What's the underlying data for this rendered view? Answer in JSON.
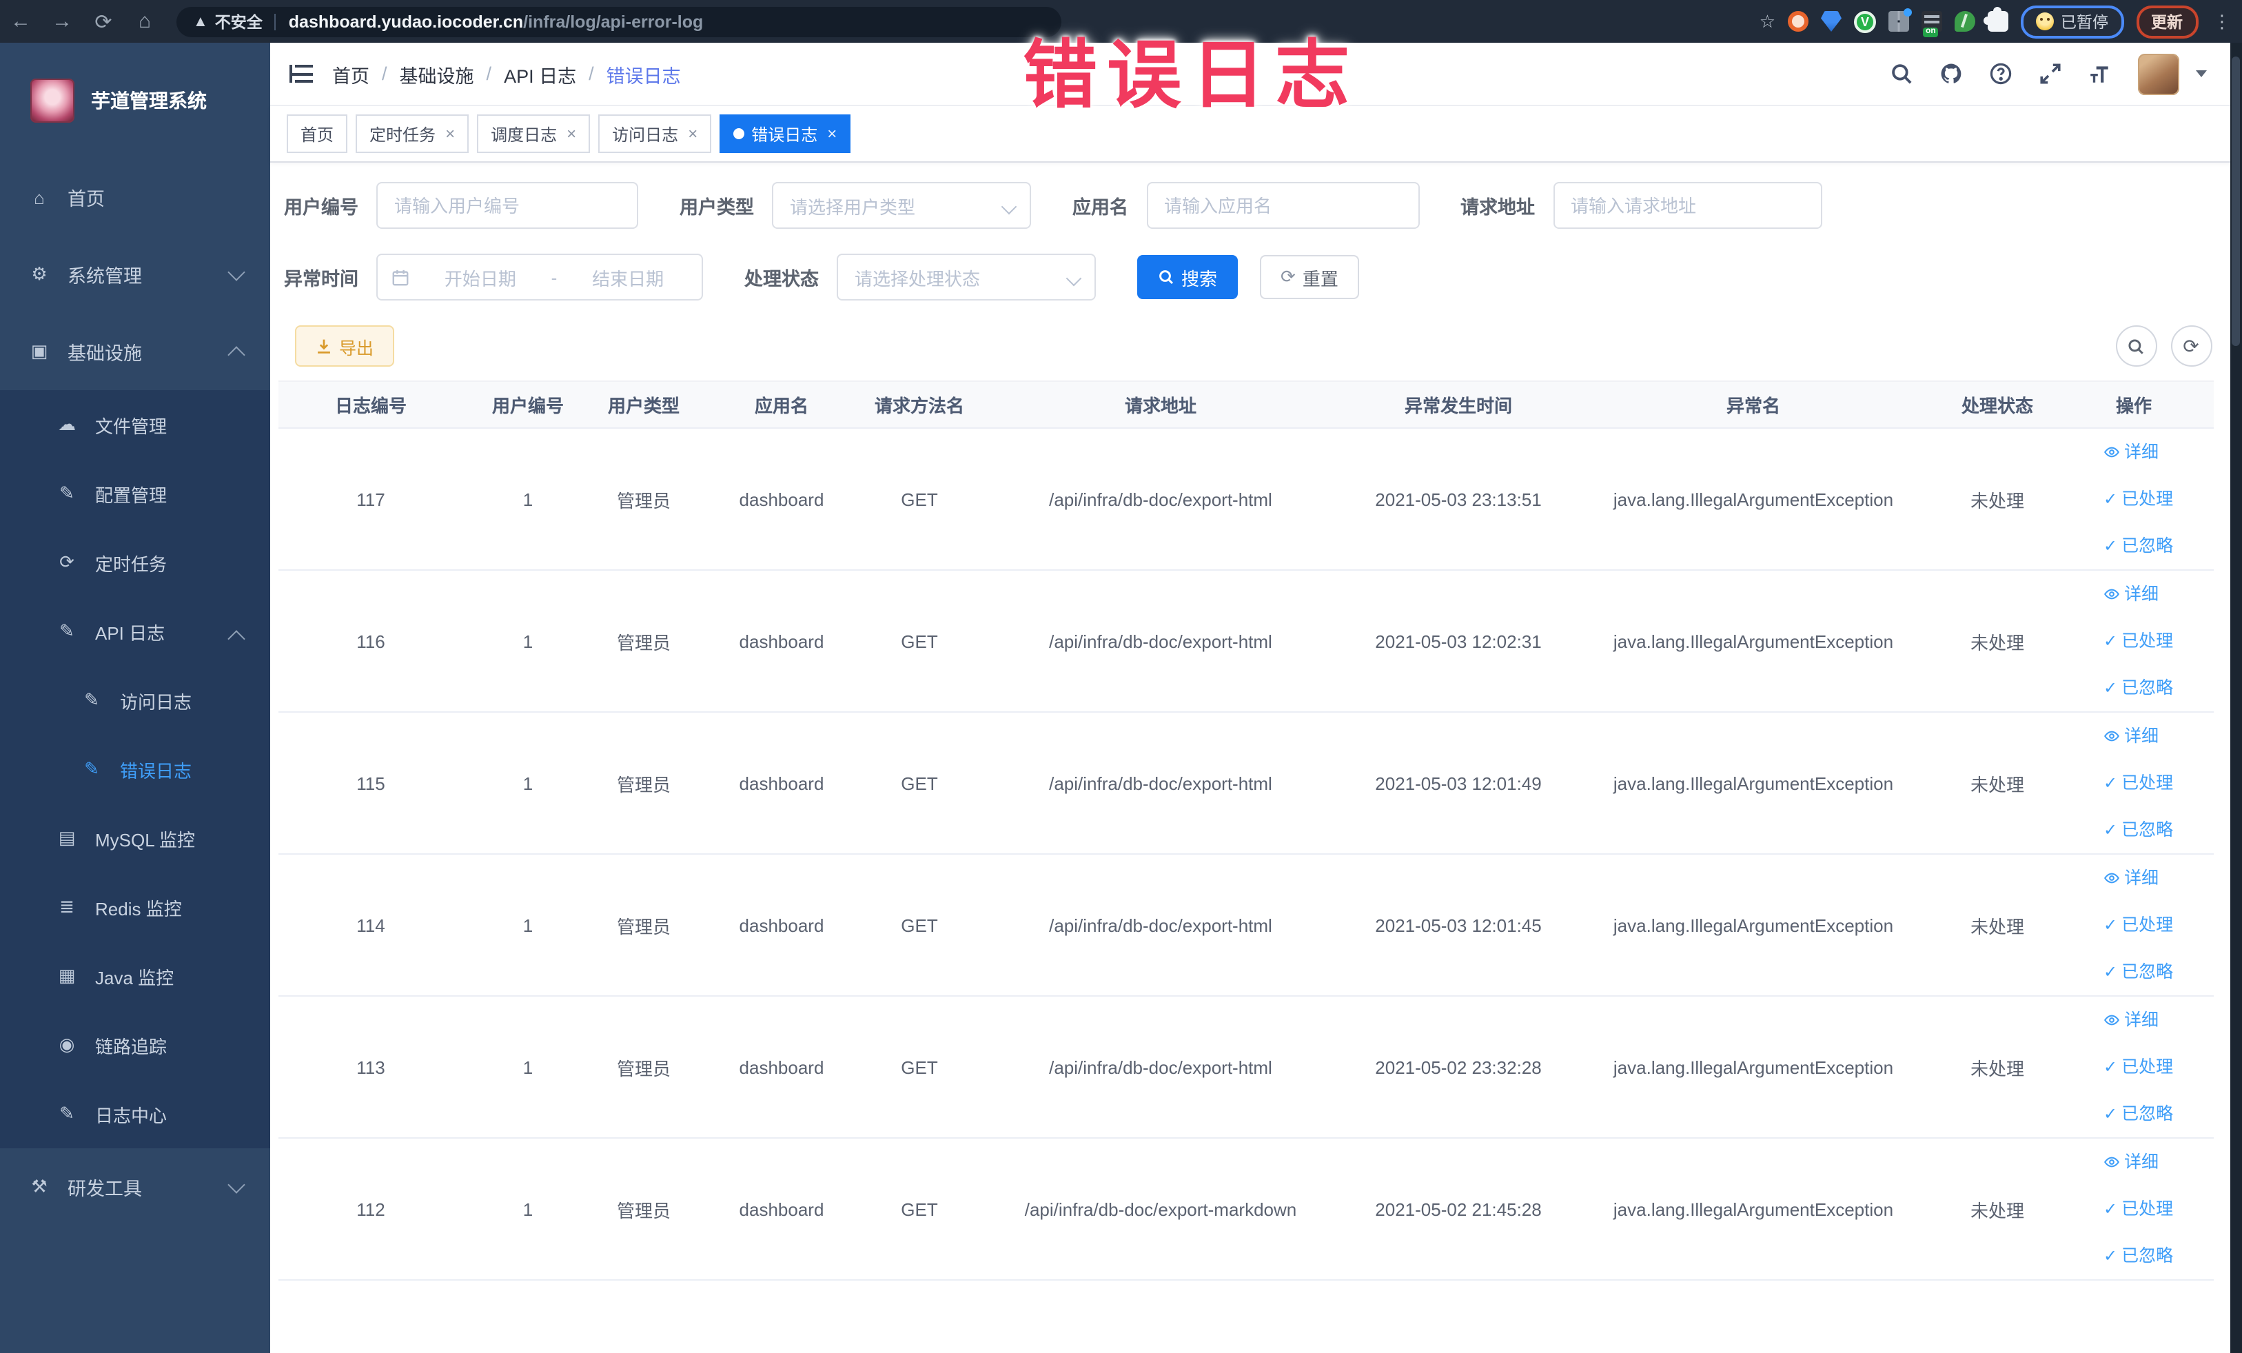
{
  "browser": {
    "security_label": "不安全",
    "url_host": "dashboard.yudao.iocoder.cn",
    "url_path": "/infra/log/api-error-log",
    "paused_badge": "已暂停",
    "update_button": "更新"
  },
  "overlay_title": "错误日志",
  "sidebar": {
    "app_title": "芋道管理系统",
    "items": [
      {
        "label": "首页",
        "icon": "home-icon",
        "level": 1,
        "sub": false,
        "chevron": "",
        "active": false
      },
      {
        "label": "系统管理",
        "icon": "gear-icon",
        "level": 1,
        "sub": false,
        "chevron": "down",
        "active": false
      },
      {
        "label": "基础设施",
        "icon": "monitor-icon",
        "level": 1,
        "sub": false,
        "chevron": "up",
        "active": false
      },
      {
        "label": "文件管理",
        "icon": "file-icon",
        "level": 2,
        "sub": true,
        "chevron": "",
        "active": false
      },
      {
        "label": "配置管理",
        "icon": "config-icon",
        "level": 2,
        "sub": true,
        "chevron": "",
        "active": false
      },
      {
        "label": "定时任务",
        "icon": "task-icon",
        "level": 2,
        "sub": true,
        "chevron": "",
        "active": false
      },
      {
        "label": "API 日志",
        "icon": "api-log-icon",
        "level": 2,
        "sub": true,
        "chevron": "up",
        "active": false
      },
      {
        "label": "访问日志",
        "icon": "access-log-icon",
        "level": 3,
        "sub": true,
        "chevron": "",
        "active": false
      },
      {
        "label": "错误日志",
        "icon": "error-log-icon",
        "level": 3,
        "sub": true,
        "chevron": "",
        "active": true
      },
      {
        "label": "MySQL 监控",
        "icon": "mysql-icon",
        "level": 2,
        "sub": true,
        "chevron": "",
        "active": false
      },
      {
        "label": "Redis 监控",
        "icon": "redis-icon",
        "level": 2,
        "sub": true,
        "chevron": "",
        "active": false
      },
      {
        "label": "Java 监控",
        "icon": "java-icon",
        "level": 2,
        "sub": true,
        "chevron": "",
        "active": false
      },
      {
        "label": "链路追踪",
        "icon": "trace-icon",
        "level": 2,
        "sub": true,
        "chevron": "",
        "active": false
      },
      {
        "label": "日志中心",
        "icon": "log-center-icon",
        "level": 2,
        "sub": true,
        "chevron": "",
        "active": false
      },
      {
        "label": "研发工具",
        "icon": "tools-icon",
        "level": 1,
        "sub": false,
        "chevron": "down",
        "active": false
      }
    ]
  },
  "navbar": {
    "breadcrumb": [
      "首页",
      "基础设施",
      "API 日志",
      "错误日志"
    ]
  },
  "tabs": [
    {
      "label": "首页",
      "closable": false,
      "active": false
    },
    {
      "label": "定时任务",
      "closable": true,
      "active": false
    },
    {
      "label": "调度日志",
      "closable": true,
      "active": false
    },
    {
      "label": "访问日志",
      "closable": true,
      "active": false
    },
    {
      "label": "错误日志",
      "closable": true,
      "active": true
    }
  ],
  "filters": {
    "user_id": {
      "label": "用户编号",
      "placeholder": "请输入用户编号"
    },
    "user_type": {
      "label": "用户类型",
      "placeholder": "请选择用户类型"
    },
    "app_name": {
      "label": "应用名",
      "placeholder": "请输入应用名"
    },
    "request_url": {
      "label": "请求地址",
      "placeholder": "请输入请求地址"
    },
    "exception_time": {
      "label": "异常时间",
      "start_placeholder": "开始日期",
      "separator": "-",
      "end_placeholder": "结束日期"
    },
    "process_status": {
      "label": "处理状态",
      "placeholder": "请选择处理状态"
    },
    "search_button": "搜索",
    "reset_button": "重置"
  },
  "toolbar": {
    "export_button": "导出"
  },
  "table": {
    "columns": [
      "日志编号",
      "用户编号",
      "用户类型",
      "应用名",
      "请求方法名",
      "请求地址",
      "异常发生时间",
      "异常名",
      "处理状态",
      "操作"
    ],
    "actions": [
      {
        "label": "详细",
        "icon": "eye-icon"
      },
      {
        "label": "已处理",
        "icon": "check-icon"
      },
      {
        "label": "已忽略",
        "icon": "check-icon"
      }
    ],
    "rows": [
      {
        "id": "117",
        "user_id": "1",
        "user_type": "管理员",
        "app": "dashboard",
        "method": "GET",
        "url": "/api/infra/db-doc/export-html",
        "time": "2021-05-03 23:13:51",
        "exception": "java.lang.IllegalArgumentException",
        "status": "未处理"
      },
      {
        "id": "116",
        "user_id": "1",
        "user_type": "管理员",
        "app": "dashboard",
        "method": "GET",
        "url": "/api/infra/db-doc/export-html",
        "time": "2021-05-03 12:02:31",
        "exception": "java.lang.IllegalArgumentException",
        "status": "未处理"
      },
      {
        "id": "115",
        "user_id": "1",
        "user_type": "管理员",
        "app": "dashboard",
        "method": "GET",
        "url": "/api/infra/db-doc/export-html",
        "time": "2021-05-03 12:01:49",
        "exception": "java.lang.IllegalArgumentException",
        "status": "未处理"
      },
      {
        "id": "114",
        "user_id": "1",
        "user_type": "管理员",
        "app": "dashboard",
        "method": "GET",
        "url": "/api/infra/db-doc/export-html",
        "time": "2021-05-03 12:01:45",
        "exception": "java.lang.IllegalArgumentException",
        "status": "未处理"
      },
      {
        "id": "113",
        "user_id": "1",
        "user_type": "管理员",
        "app": "dashboard",
        "method": "GET",
        "url": "/api/infra/db-doc/export-html",
        "time": "2021-05-02 23:32:28",
        "exception": "java.lang.IllegalArgumentException",
        "status": "未处理"
      },
      {
        "id": "112",
        "user_id": "1",
        "user_type": "管理员",
        "app": "dashboard",
        "method": "GET",
        "url": "/api/infra/db-doc/export-markdown",
        "time": "2021-05-02 21:45:28",
        "exception": "java.lang.IllegalArgumentException",
        "status": "未处理"
      }
    ]
  }
}
